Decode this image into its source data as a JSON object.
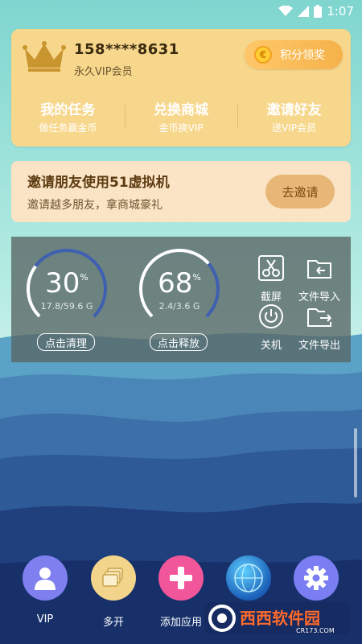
{
  "status_bar": {
    "time": "1:07"
  },
  "vip_card": {
    "phone": "158****8631",
    "membership": "永久VIP会员",
    "points_button": "积分领奖",
    "items": [
      {
        "title": "我的任务",
        "subtitle": "做任务赢金币"
      },
      {
        "title": "兑换商城",
        "subtitle": "金币换VIP"
      },
      {
        "title": "邀请好友",
        "subtitle": "送VIP会员"
      }
    ]
  },
  "invite_card": {
    "title": "邀请朋友使用51虚拟机",
    "subtitle": "邀请越多朋友，拿商城豪礼",
    "button": "去邀请"
  },
  "system_panel": {
    "gauges": [
      {
        "percent": "30",
        "unit": "%",
        "size": "17.8/59.6 G",
        "button": "点击清理",
        "fill": 0.3
      },
      {
        "percent": "68",
        "unit": "%",
        "size": "2.4/3.6 G",
        "button": "点击释放",
        "fill": 0.68
      }
    ],
    "tools": [
      {
        "label": "截屏",
        "icon": "scissors-icon"
      },
      {
        "label": "文件导入",
        "icon": "folder-import-icon"
      },
      {
        "label": "关机",
        "icon": "power-icon"
      },
      {
        "label": "文件导出",
        "icon": "folder-export-icon"
      }
    ]
  },
  "dock": [
    {
      "label": "VIP",
      "icon": "user-icon",
      "color": "#7f7ff0"
    },
    {
      "label": "多开",
      "icon": "stack-icon",
      "color": "#f2d58a"
    },
    {
      "label": "添加应用",
      "icon": "plus-icon",
      "color": "#f2569a"
    },
    {
      "label": "",
      "icon": "globe-icon",
      "color": "#2a7fd0"
    },
    {
      "label": "",
      "icon": "gear-icon",
      "color": "#7a7ef2"
    }
  ],
  "watermark": {
    "text": "西西软件园",
    "sub": "CR173.COM"
  },
  "colors": {
    "gold": "#f7d78c",
    "invite": "#fbe3c5",
    "gauge_arc": "#ffffff",
    "gauge_track": "#3f5fb0"
  }
}
